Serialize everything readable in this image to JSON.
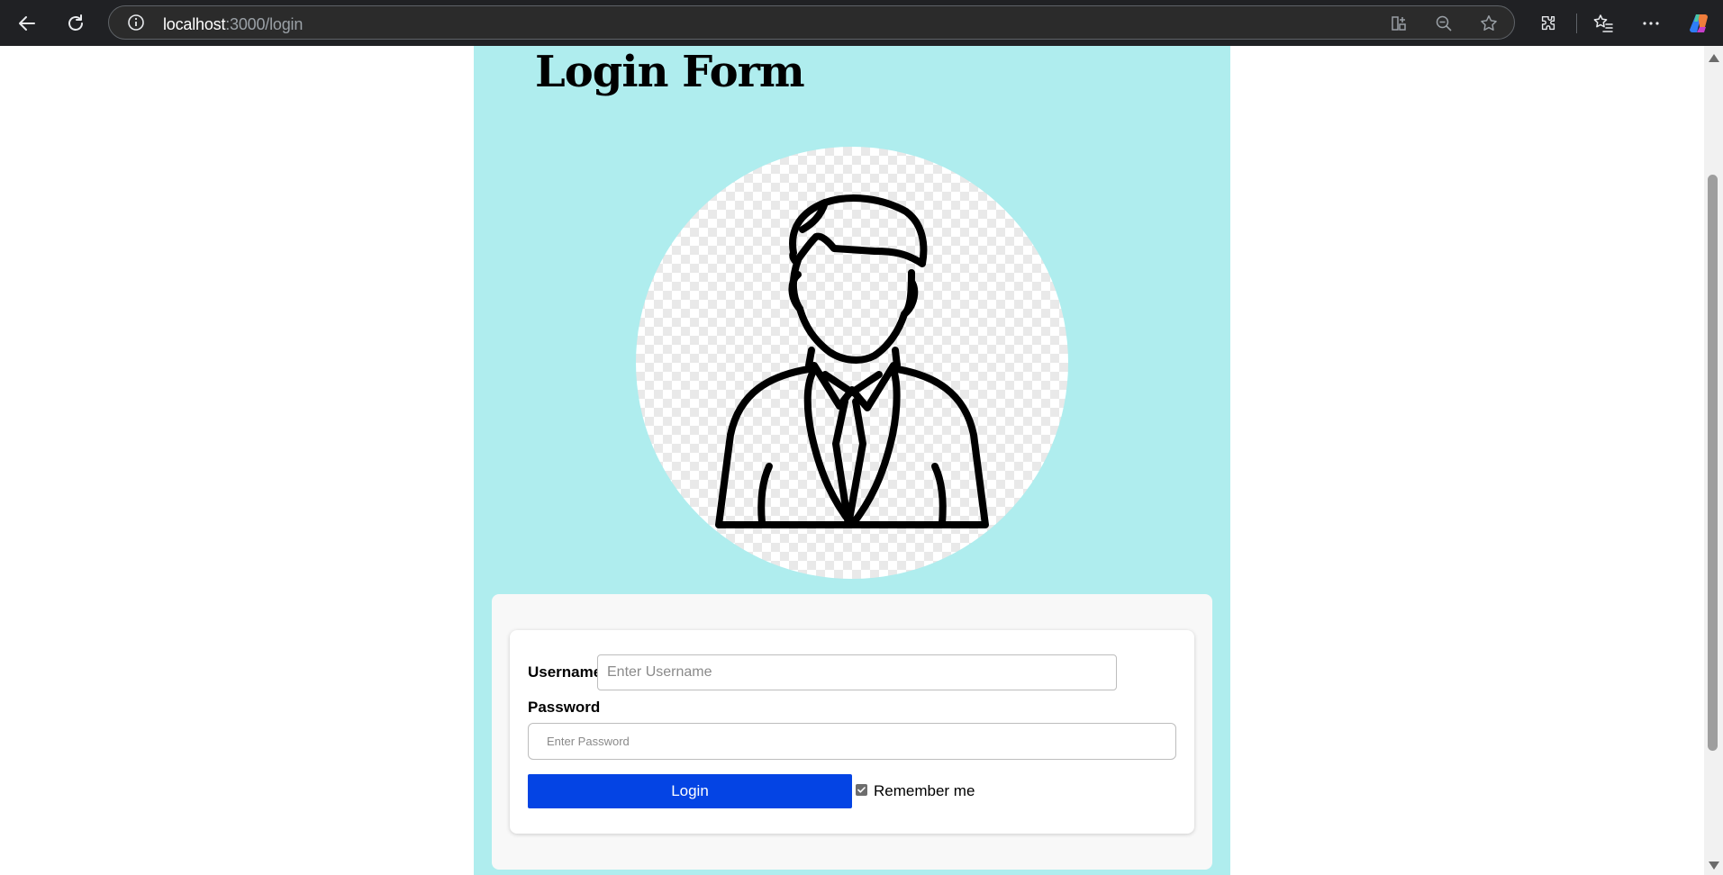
{
  "browser": {
    "url_host": "localhost",
    "url_path": ":3000/login",
    "icons": {
      "back": "back-arrow-icon",
      "refresh": "refresh-icon",
      "info": "info-icon",
      "tab_actions": "app-available-icon",
      "zoom": "zoom-out-icon",
      "favorite": "star-icon",
      "extensions": "extensions-icon",
      "favorites_list": "favorites-icon",
      "more": "more-icon",
      "copilot": "copilot-icon"
    }
  },
  "page": {
    "title": "Login Form",
    "panel_color": "#afedee",
    "avatar_icon": "person-in-suit-icon"
  },
  "form": {
    "username_label": "Username",
    "username_placeholder": "Enter Username",
    "username_value": "",
    "password_label": "Password",
    "password_placeholder": "Enter Password",
    "password_value": "",
    "login_label": "Login",
    "login_color": "#0444e4",
    "remember_label": "Remember me",
    "remember_checked": true
  }
}
